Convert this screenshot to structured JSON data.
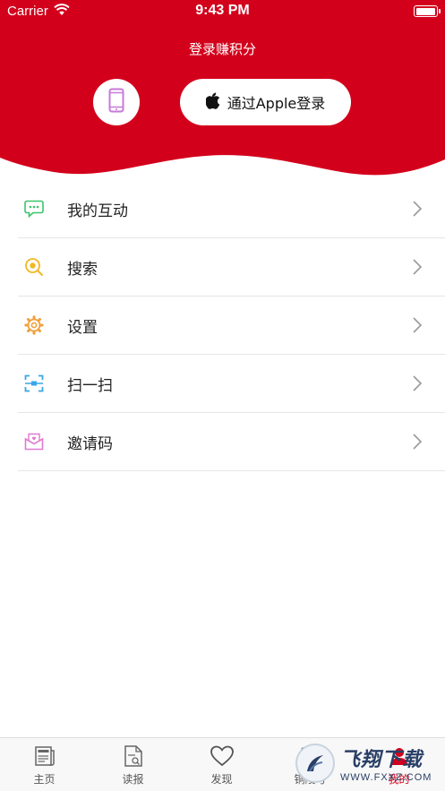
{
  "status_bar": {
    "carrier": "Carrier",
    "time": "9:43 PM",
    "battery_level": 1.0
  },
  "header": {
    "background_color": "#d3001c",
    "login_title": "登录赚积分",
    "phone_login_icon": "phone-icon",
    "apple_login_label": "通过Apple登录"
  },
  "menu": {
    "items": [
      {
        "label": "我的互动",
        "icon": "chat-bubble-icon",
        "color": "#3cc46a"
      },
      {
        "label": "搜索",
        "icon": "search-icon",
        "color": "#f2b824"
      },
      {
        "label": "设置",
        "icon": "gear-icon",
        "color": "#f0a03c"
      },
      {
        "label": "扫一扫",
        "icon": "scan-icon",
        "color": "#3aa6e8"
      },
      {
        "label": "邀请码",
        "icon": "envelope-icon",
        "color": "#e07ad0"
      }
    ]
  },
  "tabbar": {
    "active_color": "#d3001c",
    "tabs": [
      {
        "label": "主页",
        "icon": "news-icon"
      },
      {
        "label": "读报",
        "icon": "newspaper-icon"
      },
      {
        "label": "发现",
        "icon": "heart-icon"
      },
      {
        "label": "铜陵号",
        "icon": "account-icon"
      },
      {
        "label": "我的",
        "icon": "profile-icon"
      }
    ]
  },
  "watermark": {
    "main": "飞翔下载",
    "sub": "WWW.FXXZ.COM"
  }
}
